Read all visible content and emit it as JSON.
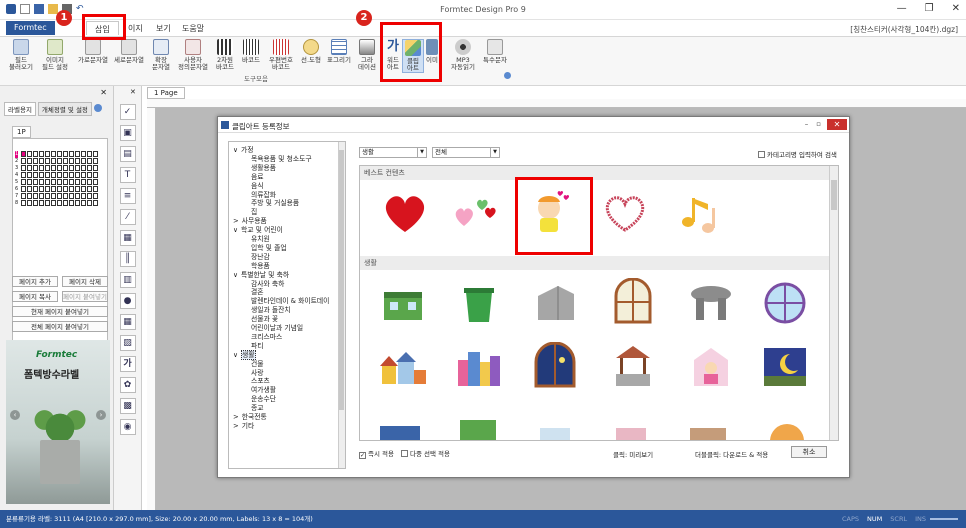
{
  "app": {
    "title": "Formtec Design Pro 9",
    "document_name": "[칭찬스티커(사각형_104칸).dgz]",
    "window_buttons": [
      "—",
      "❐",
      "✕"
    ]
  },
  "ribbon_tabs": {
    "file": "Formtec",
    "insert": "삽입",
    "page": "이지",
    "view": "보기",
    "help": "도움말"
  },
  "ribbon_buttons": [
    {
      "label": "필드\n불러오기",
      "icon": "field-load-icon"
    },
    {
      "label": "이미지\n필드 설정",
      "icon": "image-field-icon"
    },
    {
      "label": "가로문자열",
      "icon": "horizontal-text-icon"
    },
    {
      "label": "세로문자열",
      "icon": "vertical-text-icon"
    },
    {
      "label": "확장\n문자열",
      "icon": "extended-text-icon"
    },
    {
      "label": "사용자\n정의문자열",
      "icon": "custom-text-icon"
    },
    {
      "label": "2차원\n바코드",
      "icon": "qr-code-icon"
    },
    {
      "label": "바코드",
      "icon": "barcode-icon"
    },
    {
      "label": "우편번호\n바코드",
      "icon": "postal-barcode-icon"
    },
    {
      "label": "선.도형",
      "icon": "shape-icon"
    },
    {
      "label": "표그리기",
      "icon": "table-icon"
    },
    {
      "label": "그라\n데이션",
      "icon": "gradient-icon"
    },
    {
      "label": "워드\n아트",
      "icon": "wordart-icon"
    },
    {
      "label": "클립\n아트",
      "icon": "clipart-icon"
    },
    {
      "label": "이미",
      "icon": "image-icon"
    },
    {
      "label": "MP3\n자동읽기",
      "icon": "mp3-icon"
    },
    {
      "label": "특수문자",
      "icon": "special-char-icon"
    }
  ],
  "ribbon_group_label": "도구모음",
  "badges": [
    "1",
    "2"
  ],
  "left_panel": {
    "tabs": [
      "라벨용지",
      "개체정렬 및 설정"
    ],
    "page_tab": "1P",
    "row_numbers": [
      "1",
      "2",
      "3",
      "4",
      "5",
      "6",
      "7",
      "8"
    ],
    "buttons": {
      "add_page": "페이지 추가",
      "delete_page": "페이지 삭제",
      "copy_page": "페이지 복사",
      "paste_page": "페이지 붙여넣기",
      "paste_current": "현재 페이지 붙여넣기",
      "paste_all": "전체 페이지 붙여넣기"
    },
    "ad": {
      "brand": "Formtec",
      "title": "폼텍방수라벨"
    }
  },
  "document_tab": "1 Page",
  "dialog": {
    "title": "클립아트 등록정보",
    "dropdown_category": "생활",
    "dropdown_filter": "전체",
    "search_checkbox": "카테고리명 입력하여 검색",
    "section_best": "베스트 컨텐츠",
    "section_life": "생활",
    "footer": {
      "immediate_apply": "즉시 적용",
      "multi_select": "다중 선택 적용",
      "click_hint": "클릭: 미리보기",
      "dblclick_hint": "더블클릭: 다운로드 & 적용",
      "cancel": "취소"
    },
    "tree": [
      {
        "text": "가정",
        "level": 0,
        "expander": "∨"
      },
      {
        "text": "목욕용품 및 청소도구",
        "level": 1
      },
      {
        "text": "생활용품",
        "level": 1
      },
      {
        "text": "음료",
        "level": 1
      },
      {
        "text": "음식",
        "level": 1
      },
      {
        "text": "의류잡화",
        "level": 1
      },
      {
        "text": "주방 및 거실용품",
        "level": 1
      },
      {
        "text": "집",
        "level": 1
      },
      {
        "text": "사무용품",
        "level": 0,
        "expander": ">"
      },
      {
        "text": "학교 및 어린이",
        "level": 0,
        "expander": "∨"
      },
      {
        "text": "유치원",
        "level": 1
      },
      {
        "text": "입학 및 졸업",
        "level": 1
      },
      {
        "text": "장난감",
        "level": 1
      },
      {
        "text": "학용품",
        "level": 1
      },
      {
        "text": "특별한날 및 축하",
        "level": 0,
        "expander": "∨"
      },
      {
        "text": "감사와 축하",
        "level": 1
      },
      {
        "text": "결혼",
        "level": 1
      },
      {
        "text": "발렌타인데이 & 화이트데이",
        "level": 1
      },
      {
        "text": "생일과 돌잔치",
        "level": 1
      },
      {
        "text": "선물과 꽃",
        "level": 1
      },
      {
        "text": "어린이날과 기념일",
        "level": 1
      },
      {
        "text": "크리스마스",
        "level": 1
      },
      {
        "text": "파티",
        "level": 1
      },
      {
        "text": "생활",
        "level": 0,
        "expander": "∨"
      },
      {
        "text": "건물",
        "level": 1
      },
      {
        "text": "사랑",
        "level": 1
      },
      {
        "text": "스포츠",
        "level": 1
      },
      {
        "text": "여가생활",
        "level": 1
      },
      {
        "text": "운송수단",
        "level": 1
      },
      {
        "text": "종교",
        "level": 1
      },
      {
        "text": "한국전통",
        "level": 0,
        "expander": ">"
      },
      {
        "text": "기타",
        "level": 0,
        "expander": ">"
      }
    ],
    "best_icons": [
      "red-heart-icon",
      "small-hearts-icon",
      "girl-hearts-icon",
      "glitter-heart-icon",
      "music-notes-icon"
    ],
    "life_icons_row1": [
      "green-building-icon",
      "green-trash-can-icon",
      "gray-building-icon",
      "window-icon",
      "stone-dolmen-icon",
      "round-window-icon"
    ],
    "life_icons_row2": [
      "village-icon",
      "colorful-city-icon",
      "night-window-icon",
      "wishing-well-icon",
      "girl-window-icon",
      "moon-night-icon"
    ]
  },
  "status_bar": {
    "info": "분류류기용 라벨: 3111 (A4 [210.0 x 297.0 mm], Size: 20.00 x 20.00 mm, Labels: 13 x 8 = 104개)",
    "indicators": [
      "CAPS",
      "NUM",
      "SCRL",
      "INS"
    ],
    "indicator_active": [
      false,
      true,
      false,
      false
    ]
  },
  "colors": {
    "accent": "#2b579a",
    "highlight_red": "#e00000"
  }
}
